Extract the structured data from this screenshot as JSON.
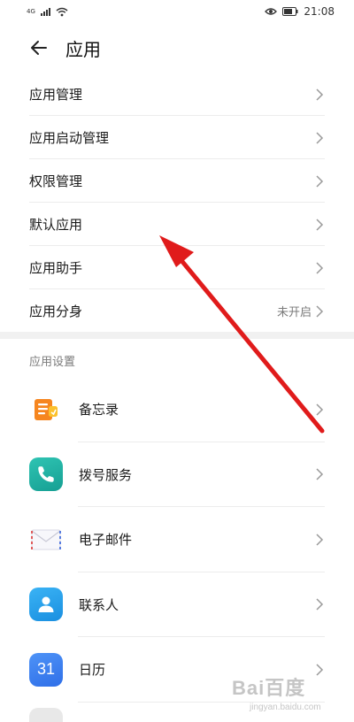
{
  "status_bar": {
    "network": "4G",
    "time": "21:08"
  },
  "header": {
    "title": "应用"
  },
  "menu": [
    {
      "label": "应用管理",
      "value": ""
    },
    {
      "label": "应用启动管理",
      "value": ""
    },
    {
      "label": "权限管理",
      "value": ""
    },
    {
      "label": "默认应用",
      "value": ""
    },
    {
      "label": "应用助手",
      "value": ""
    },
    {
      "label": "应用分身",
      "value": "未开启"
    }
  ],
  "section": {
    "title": "应用设置"
  },
  "apps": [
    {
      "label": "备忘录",
      "icon": "notes-icon"
    },
    {
      "label": "拨号服务",
      "icon": "phone-icon"
    },
    {
      "label": "电子邮件",
      "icon": "mail-icon"
    },
    {
      "label": "联系人",
      "icon": "contacts-icon"
    },
    {
      "label": "日历",
      "icon": "calendar-icon",
      "icon_text": "31"
    }
  ],
  "watermark": {
    "logo": "Bai百度",
    "sub": "jingyan.baidu.com"
  },
  "colors": {
    "annotation_arrow": "#e01b1b",
    "phone_icon": "#1fb5a6",
    "contacts_icon": "#2a9fef",
    "calendar_icon": "#3b7ff0",
    "notes_icon": "#f6861f"
  }
}
